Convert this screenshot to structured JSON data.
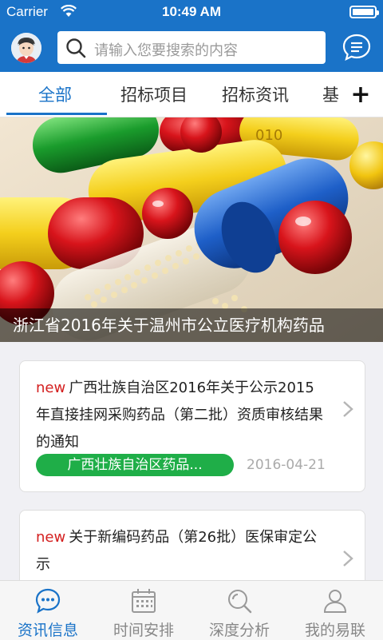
{
  "status": {
    "carrier": "Carrier",
    "time": "10:49 AM",
    "battery_level": 1.0
  },
  "search": {
    "placeholder": "请输入您要搜索的内容"
  },
  "tabs": [
    {
      "label": "全部"
    },
    {
      "label": "招标项目"
    },
    {
      "label": "招标资讯"
    },
    {
      "label": "基"
    }
  ],
  "tabs_add_label": "+",
  "banner": {
    "caption": "浙江省2016年关于温州市公立医疗机构药品"
  },
  "news": [
    {
      "badge": "new",
      "title": "广西壮族自治区2016年关于公示2015年直接挂网采购药品（第二批）资质审核结果的通知",
      "tag": "广西壮族自治区药品...",
      "date": "2016-04-21"
    },
    {
      "badge": "new",
      "title": "关于新编码药品（第26批）医保审定公示"
    }
  ],
  "bottom_nav": [
    {
      "label": "资讯信息",
      "icon": "chat-bubble-icon"
    },
    {
      "label": "时间安排",
      "icon": "calendar-icon"
    },
    {
      "label": "深度分析",
      "icon": "magnifier-icon"
    },
    {
      "label": "我的易联",
      "icon": "user-icon"
    }
  ],
  "colors": {
    "primary": "#1a73c8",
    "tag_green": "#1fae48",
    "new_red": "#d42020"
  }
}
